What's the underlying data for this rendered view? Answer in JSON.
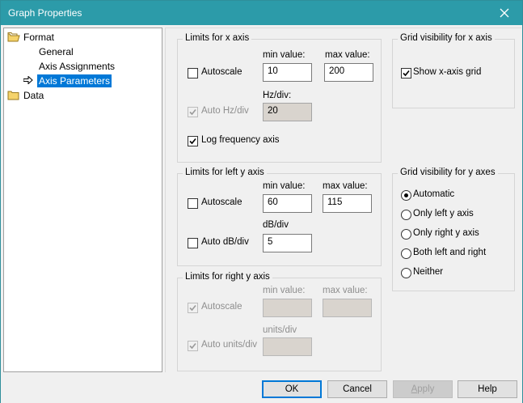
{
  "window": {
    "title": "Graph Properties"
  },
  "tree": {
    "items": [
      {
        "label": "Format"
      },
      {
        "label": "General"
      },
      {
        "label": "Axis Assignments"
      },
      {
        "label": "Axis Parameters"
      },
      {
        "label": "Data"
      }
    ]
  },
  "x_axis": {
    "legend": "Limits for x axis",
    "autoscale_label": "Autoscale",
    "autoscale_checked": false,
    "min_label": "min value:",
    "max_label": "max value:",
    "min_value": "10",
    "max_value": "200",
    "auto_hz_label": "Auto Hz/div",
    "auto_hz_checked": true,
    "hz_div_label": "Hz/div:",
    "hz_div_value": "20",
    "log_label": "Log frequency axis",
    "log_checked": true
  },
  "left_y": {
    "legend": "Limits for left y axis",
    "autoscale_label": "Autoscale",
    "autoscale_checked": false,
    "min_label": "min value:",
    "max_label": "max value:",
    "min_value": "60",
    "max_value": "115",
    "auto_db_label": "Auto dB/div",
    "auto_db_checked": false,
    "db_div_label": "dB/div",
    "db_div_value": "5"
  },
  "right_y": {
    "legend": "Limits for right y axis",
    "autoscale_label": "Autoscale",
    "autoscale_checked": true,
    "min_label": "min value:",
    "max_label": "max value:",
    "min_value": "",
    "max_value": "",
    "auto_units_label": "Auto units/div",
    "auto_units_checked": true,
    "units_div_label": "units/div",
    "units_div_value": ""
  },
  "grid_x": {
    "legend": "Grid visibility for x axis",
    "show_label": "Show x-axis grid",
    "show_checked": true
  },
  "grid_y": {
    "legend": "Grid visibility for y axes",
    "selected": "Automatic",
    "options": [
      "Automatic",
      "Only left y axis",
      "Only right y axis",
      "Both left and right",
      "Neither"
    ]
  },
  "buttons": {
    "ok": "OK",
    "cancel": "Cancel",
    "apply_underlined": "A",
    "apply_rest": "pply",
    "help": "Help"
  },
  "colors": {
    "titlebar": "#2c9ba9",
    "selection": "#0078d7"
  }
}
